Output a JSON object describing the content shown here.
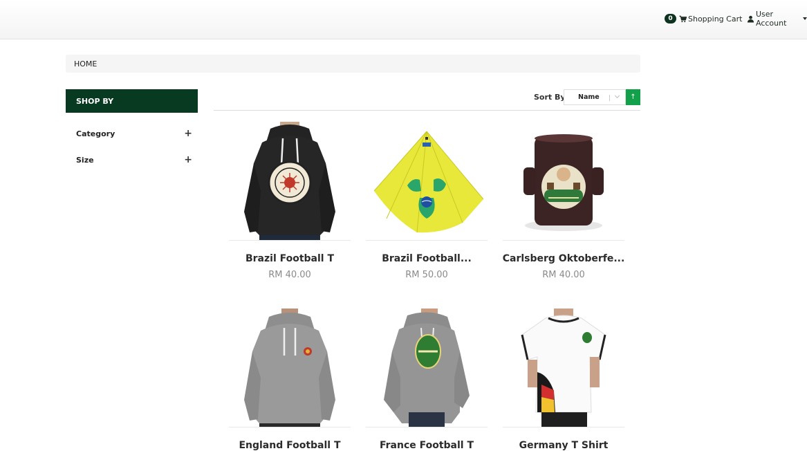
{
  "header": {
    "cart_count": "0",
    "cart_label": "Shopping Cart",
    "account_label": "User Account"
  },
  "breadcrumb": {
    "home": "HOME"
  },
  "sidebar": {
    "title": "SHOP BY",
    "filters": [
      {
        "label": "Category",
        "toggle": "+"
      },
      {
        "label": "Size",
        "toggle": "+"
      }
    ]
  },
  "sort": {
    "label": "Sort By",
    "selected": "Name",
    "direction_symbol": "↑"
  },
  "products": [
    {
      "name": "Brazil Football T",
      "price": "RM 40.00",
      "image": "black-hoodie"
    },
    {
      "name": "Brazil Football...",
      "price": "RM 50.00",
      "image": "yellow-umbrella"
    },
    {
      "name": "Carlsberg Oktoberfe...",
      "price": "RM 40.00",
      "image": "beer-mug"
    },
    {
      "name": "England Football T",
      "price": "",
      "image": "grey-hoodie"
    },
    {
      "name": "France Football T",
      "price": "",
      "image": "grey-hoodie-logo"
    },
    {
      "name": "Germany T Shirt",
      "price": "",
      "image": "white-tshirt"
    }
  ],
  "colors": {
    "brand_dark_green": "#073a21",
    "sort_button_green": "#13a04a",
    "price_grey": "#8a8a8a"
  }
}
